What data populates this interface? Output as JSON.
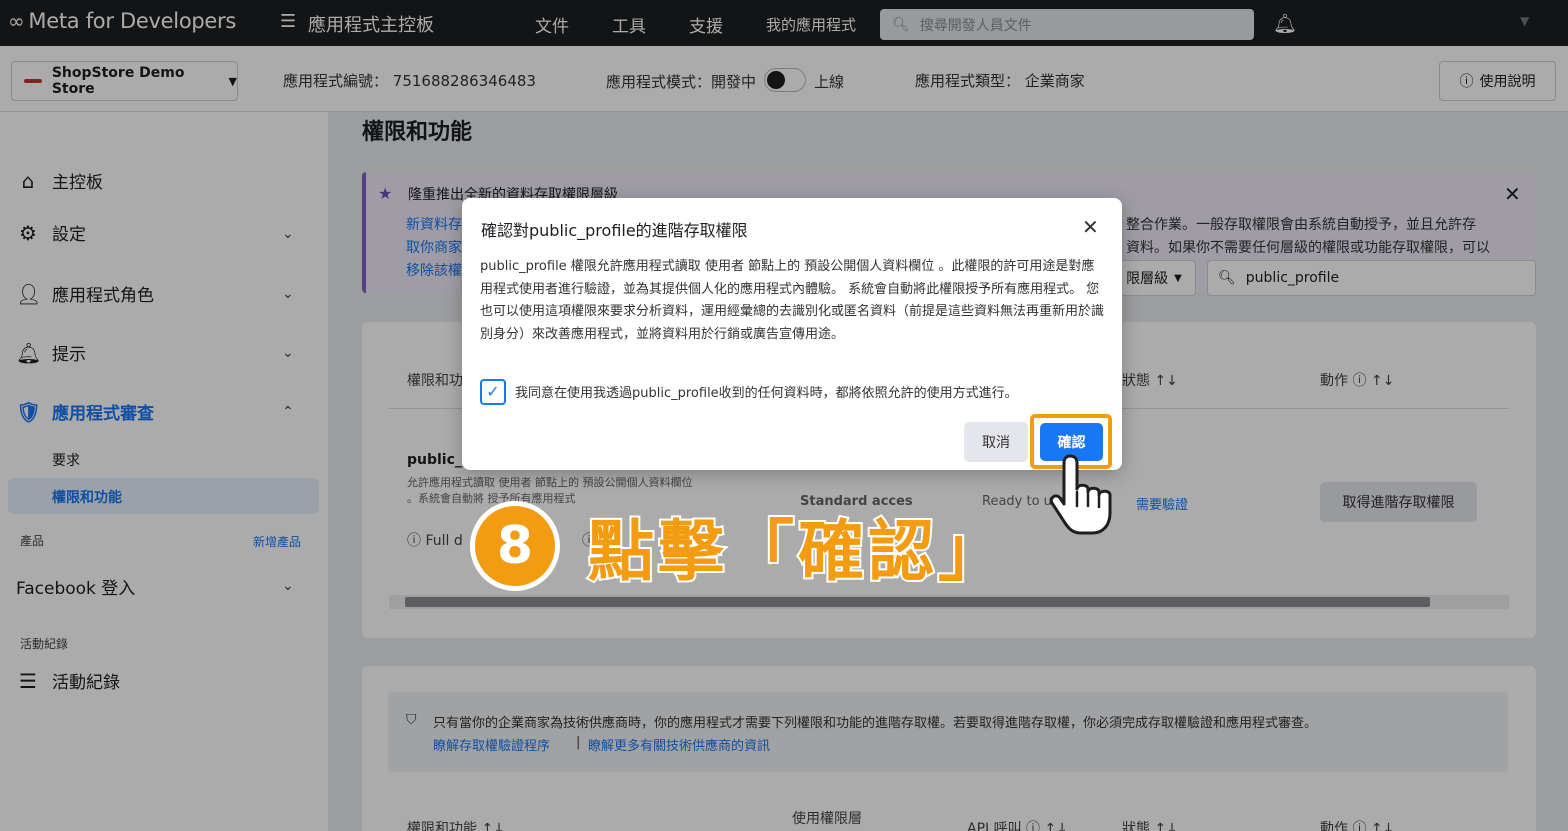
{
  "topbar": {
    "logo_text": "Meta for Developers",
    "dashboard_title": "應用程式主控板",
    "nav": [
      "文件",
      "工具",
      "支援",
      "我的應用程式"
    ],
    "search_placeholder": "搜尋開發人員文件"
  },
  "subbar": {
    "store_name": "ShopStore Demo Store",
    "app_id_label": "應用程式編號：",
    "app_id": "751688286346483",
    "mode_label": "應用程式模式：開發中",
    "mode_live": "上線",
    "type_label": "應用程式類型：",
    "type_value": "企業商家",
    "help_label": "使用說明"
  },
  "sidebar": {
    "items": [
      {
        "label": "主控板",
        "icon": "home-icon"
      },
      {
        "label": "設定",
        "icon": "gear-icon"
      },
      {
        "label": "應用程式角色",
        "icon": "roles-icon"
      },
      {
        "label": "提示",
        "icon": "bell-icon"
      },
      {
        "label": "應用程式審查",
        "icon": "shield-icon"
      }
    ],
    "sub_items": [
      "要求",
      "權限和功能"
    ],
    "products_label": "產品",
    "add_product": "新增產品",
    "facebook_login": "Facebook 登入",
    "activity_section": "活動紀錄",
    "activity_item": "活動紀錄"
  },
  "main": {
    "page_title": "權限和功能",
    "banner_title": "隆重推出全新的資料存取權限層級",
    "banner_body_left": "新資料存\n取你商家\n移除該權",
    "banner_body_right": "整合作業。一般存取權限會由系統自動授予，並且允許存\n資料。如果你不需要任何層級的權限或功能存取權限，可以",
    "filter_label": "限層級",
    "filter_search": "public_profile",
    "col_permission": "權限和功",
    "col_status": "狀態",
    "col_action": "動作",
    "row_name": "public_p",
    "row_desc1": "允許應用程式讀取 使用者 節點上的 預設公開個人資料欄位",
    "row_desc2": "。系統會自動將",
    "row_desc3": "授予所有應用程式",
    "row_access": "Standard acces",
    "row_ready": "Ready to use",
    "row_verify": "需要驗證",
    "row_btn": "取得進階存取權限",
    "row_info1": "Full d",
    "row_info2": "R",
    "info_notice": "只有當你的企業商家為技術供應商時，你的應用程式才需要下列權限和功能的進階存取權。若要取得進階存取權，你必須完成存取權驗證和應用程式審查。",
    "info_link1": "瞭解存取權驗證程序",
    "info_link2": "瞭解更多有關技術供應商的資訊",
    "col2_permission": "權限和功能",
    "col2_level": "使用權限層",
    "col2_api": "API 呼叫",
    "col2_status": "狀態",
    "col2_action": "動作"
  },
  "modal": {
    "title": "確認對public_profile的進階存取權限",
    "body": "public_profile 權限允許應用程式讀取 使用者 節點上的 預設公開個人資料欄位 。此權限的許可用途是對應用程式使用者進行驗證，並為其提供個人化的應用程式內體驗。 系統會自動將此權限授予所有應用程式。 您也可以使用這項權限來要求分析資料，運用經彙總的去識別化或匿名資料（前提是這些資料無法再重新用於識別身分）來改善應用程式，並將資料用於行銷或廣告宣傳用途。",
    "checkbox_label": "我同意在使用我透過public_profile收到的任何資料時，都將依照允許的使用方式進行。",
    "cancel": "取消",
    "confirm": "確認"
  },
  "annotation": {
    "step_number": "8",
    "step_text": "點擊「確認」"
  },
  "colors": {
    "accent": "#1877f2",
    "annotation": "#f39c12",
    "topbar": "#1c1e21"
  }
}
